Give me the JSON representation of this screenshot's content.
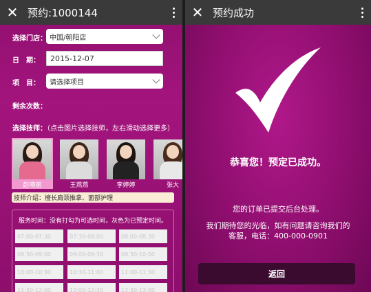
{
  "left": {
    "title": "预约:1000144",
    "store_label": "选择门店：",
    "store_value": "中国/朝阳店",
    "date_label": "日　期：",
    "date_value": "2015-12-07",
    "item_label": "项　目：",
    "item_value": "请选择项目",
    "remaining_label": "剩余次数：",
    "tech_label": "选择技师：",
    "tech_hint": "（点击图片选择技师，左右滑动选择更多）",
    "technicians": [
      {
        "name": "赵晓丽",
        "selected": true
      },
      {
        "name": "王燕燕",
        "selected": false
      },
      {
        "name": "李婷婷",
        "selected": false
      },
      {
        "name": "张大",
        "selected": false
      }
    ],
    "tech_intro": "技师介绍：擅长肩颈推拿、面部护理",
    "slots_title": "服务时间：没有打勾为可选时间，灰色为已预定时间。",
    "slots": [
      "07:00-07:30",
      "07:30-08:00",
      "08:00-08:30",
      "08:30-09:00",
      "09:00-09:30",
      "09:30-10:00",
      "10:00-10:30",
      "10:30-11:00",
      "11:00-11:30",
      "11:30-12:00",
      "12:00-12:30",
      "12:30-13:00"
    ]
  },
  "right": {
    "title": "预约成功",
    "congrats": "恭喜您！预定已成功。",
    "msg1": "您的订单已提交后台处理。",
    "msg2": "我们期待您的光临，如有问题请咨询我们的",
    "msg3": "客服，电话：400-000-0901",
    "back_label": "返回"
  },
  "icons": {
    "close": "close-icon",
    "more": "more-vertical-icon",
    "check": "checkmark-icon",
    "chevron": "chevron-down-icon"
  },
  "colors": {
    "accent": "#a3147d",
    "topbar": "#3a3a3a",
    "button": "#3a0b2f"
  }
}
